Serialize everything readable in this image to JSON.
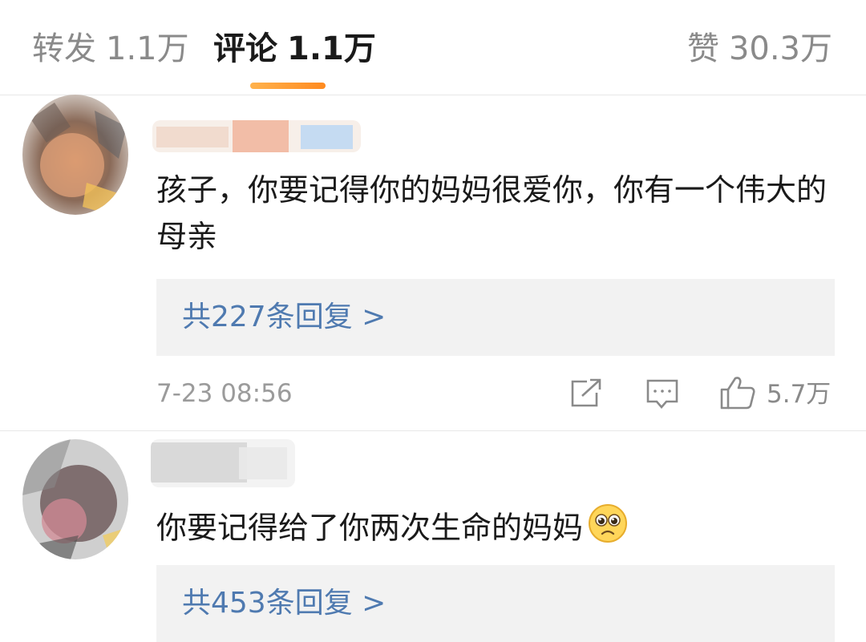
{
  "tabs": {
    "repost": {
      "label": "转发",
      "count": "1.1万"
    },
    "comment": {
      "label": "评论",
      "count": "1.1万"
    },
    "like": {
      "label": "赞",
      "count": "30.3万"
    }
  },
  "colors": {
    "accent": "#ff9a2e",
    "link": "#4f7ab0",
    "reply_bg": "#f2f2f2"
  },
  "comments": [
    {
      "text": "孩子，你要记得你的妈妈很爱你，你有一个伟大的母亲",
      "replies": "共227条回复 >",
      "time": "7-23 08:56",
      "likes": "5.7万",
      "icons": [
        "share-icon",
        "comment-icon",
        "thumbs-up-icon"
      ]
    },
    {
      "text": "你要记得给了你两次生命的妈妈",
      "emoji": "teary-eyes-emoji",
      "replies": "共453条回复 >"
    }
  ]
}
